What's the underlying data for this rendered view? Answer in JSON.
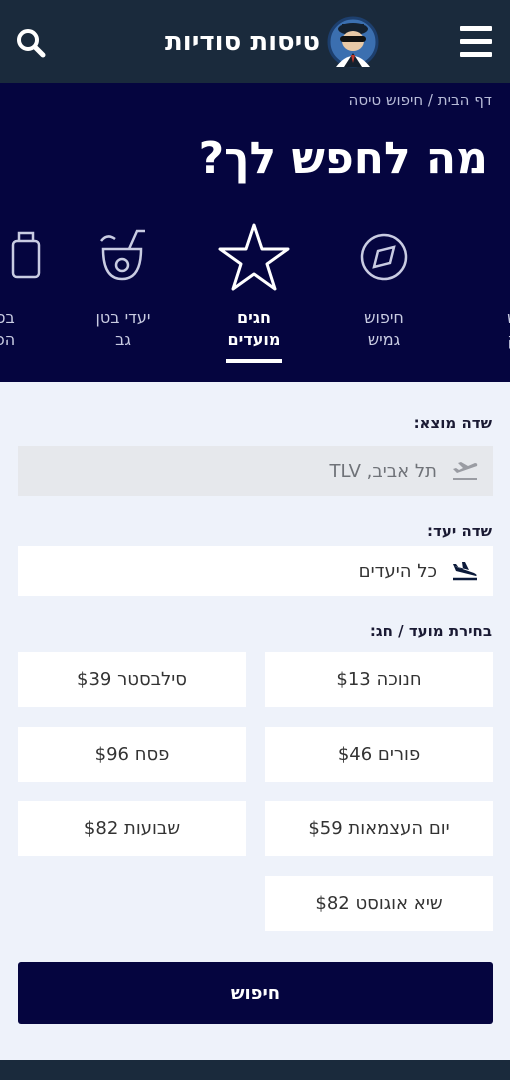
{
  "header": {
    "brand_name": "טיסות סודיות",
    "logo_icon": "spy-mascot-logo",
    "search_icon": "search-icon",
    "menu_icon": "hamburger-menu-icon",
    "background_color": "#1a2a3c"
  },
  "hero": {
    "breadcrumb": "דף הבית / חיפוש טיסה",
    "title": "מה לחפש לך?",
    "background_color": "#05053f",
    "categories": [
      {
        "label_line1": "בס",
        "label_line2": "הפ",
        "icon": "suitcase-icon",
        "active": false
      },
      {
        "label_line1": "יעדי בטן",
        "label_line2": "גב",
        "icon": "coconut-drink-icon",
        "active": false
      },
      {
        "label_line1": "חגים",
        "label_line2": "מועדים",
        "icon": "star-icon",
        "active": true
      },
      {
        "label_line1": "חיפוש",
        "label_line2": "גמיש",
        "icon": "compass-icon",
        "active": false
      },
      {
        "label_line1": "וש",
        "label_line2": "יק",
        "icon": "globe-icon",
        "active": false
      }
    ]
  },
  "form": {
    "origin_label": "שדה מוצא:",
    "origin_value": "תל אביב, TLV",
    "origin_icon": "plane-takeoff-icon",
    "destination_label": "שדה יעד:",
    "destination_value": "כל היעדים",
    "destination_icon": "plane-landing-icon",
    "holiday_label": "בחירת מועד / חג:",
    "holidays": [
      {
        "label": "חנוכה $13"
      },
      {
        "label": "סילבסטר $39"
      },
      {
        "label": "פורים $46"
      },
      {
        "label": "פסח $96"
      },
      {
        "label": "יום העצמאות $59"
      },
      {
        "label": "שבועות $82"
      },
      {
        "label": "שיא אוגוסט $82"
      }
    ],
    "search_button": "חיפוש"
  }
}
